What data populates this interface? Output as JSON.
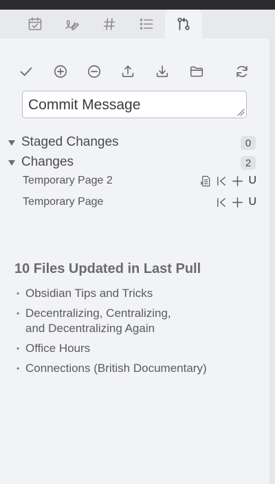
{
  "tabs": [
    {
      "icon": "calendar-icon"
    },
    {
      "icon": "signature-icon"
    },
    {
      "icon": "hashtag-icon"
    },
    {
      "icon": "list-icon"
    },
    {
      "icon": "source-control-icon",
      "active": true
    }
  ],
  "toolbar": [
    {
      "name": "commit-button",
      "icon": "checkmark-icon"
    },
    {
      "name": "stage-all-button",
      "icon": "plus-circle-icon"
    },
    {
      "name": "unstage-all-button",
      "icon": "minus-circle-icon"
    },
    {
      "name": "push-button",
      "icon": "upload-icon"
    },
    {
      "name": "pull-button",
      "icon": "download-icon"
    },
    {
      "name": "change-layout-button",
      "icon": "folder-icon"
    },
    {
      "name": "refresh-button",
      "icon": "refresh-icon"
    }
  ],
  "commit": {
    "placeholder": "Commit Message"
  },
  "staged": {
    "label": "Staged Changes",
    "count": "0"
  },
  "changes": {
    "label": "Changes",
    "count": "2",
    "files": [
      {
        "name": "Temporary Page 2",
        "status": "U",
        "has_open_icon": true
      },
      {
        "name": "Temporary Page",
        "status": "U",
        "has_open_icon": false
      }
    ]
  },
  "pull": {
    "title": "10 Files Updated in Last Pull",
    "items": [
      "Obsidian Tips and Tricks",
      "Decentralizing, Centralizing, and Decentralizing Again",
      "Office Hours",
      "Connections (British Documentary)"
    ]
  },
  "colors": {
    "background": "#f2f3f6",
    "tab_strip": "#e8e9ed",
    "top_bar": "#2b2b2e",
    "icon": "#6a6a70"
  }
}
